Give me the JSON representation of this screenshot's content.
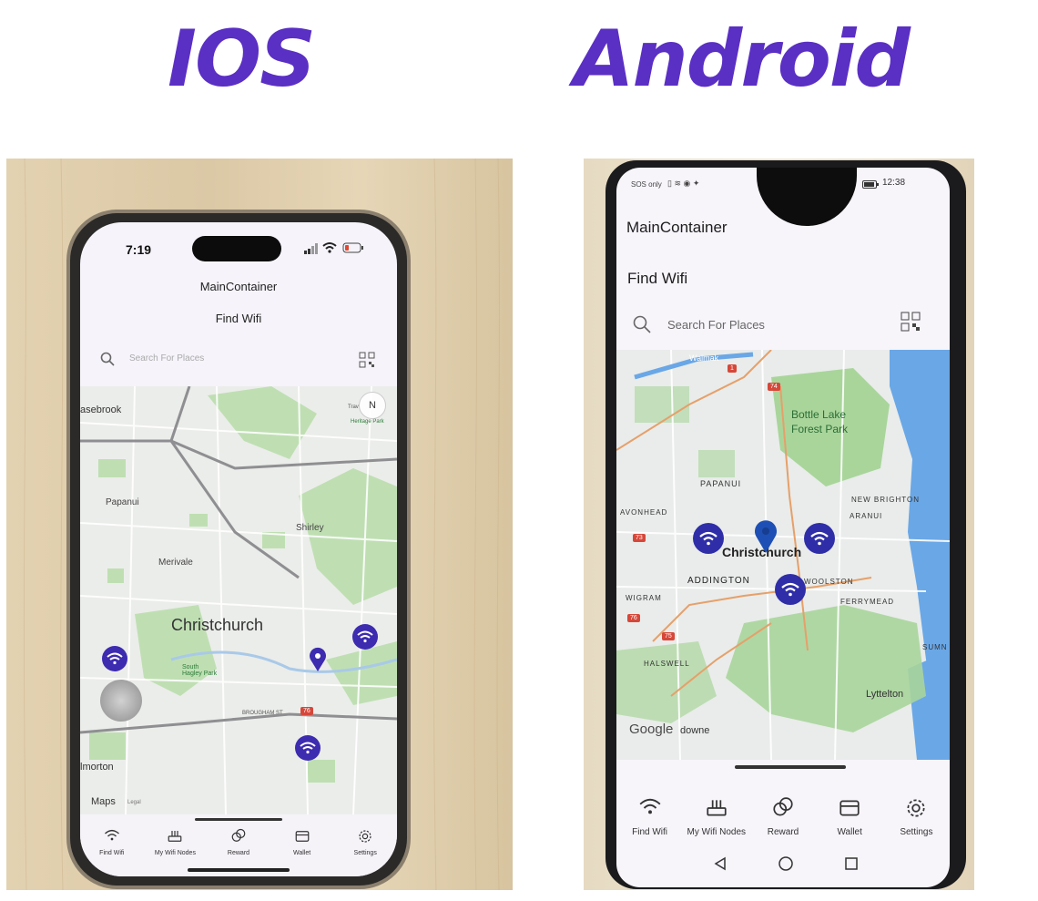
{
  "headings": {
    "ios": "IOS",
    "android": "Android"
  },
  "ios": {
    "status_time": "7:19",
    "app_title": "MainContainer",
    "page_title": "Find Wifi",
    "search_placeholder": "Search For Places",
    "map_labels": {
      "place1": "asebrook",
      "place2": "Papanui",
      "place3": "Shirley",
      "place4": "Merivale",
      "city": "Christchurch",
      "park": "South Hagley Park",
      "place5": "lmorton",
      "road": "BROUGHAM ST",
      "route": "76",
      "attribution": "Maps",
      "legal": "Legal",
      "compass": "N",
      "corner1": "Trav",
      "corner2": "Heritage Park"
    },
    "tabs": [
      {
        "label": "Find Wifi",
        "icon": "wifi-icon"
      },
      {
        "label": "My Wifi Nodes",
        "icon": "router-icon"
      },
      {
        "label": "Reward",
        "icon": "coins-icon"
      },
      {
        "label": "Wallet",
        "icon": "wallet-icon"
      },
      {
        "label": "Settings",
        "icon": "gear-icon"
      }
    ]
  },
  "android": {
    "status_left": "SOS only",
    "status_time": "12:38",
    "app_title": "MainContainer",
    "page_title": "Find Wifi",
    "search_placeholder": "Search For Places",
    "map_labels": {
      "top": "Waimak",
      "lake": "Bottle Lake",
      "forest": "Forest Park",
      "papanui": "PAPANUI",
      "new_brighton": "NEW BRIGHTON",
      "avonhead": "AVONHEAD",
      "aranui": "ARANUI",
      "city": "Christchurch",
      "addington": "ADDINGTON",
      "woolston": "WOOLSTON",
      "wigram": "WIGRAM",
      "ferrymead": "FERRYMEAD",
      "halswell": "HALSWELL",
      "sumner": "SUMN",
      "lyttelton": "Lyttelton",
      "google": "Google",
      "downe": "downe",
      "route1": "1",
      "route74": "74",
      "route73": "73",
      "route75": "75",
      "route76": "76"
    },
    "tabs": [
      {
        "label": "Find Wifi",
        "icon": "wifi-icon"
      },
      {
        "label": "My Wifi Nodes",
        "icon": "router-icon"
      },
      {
        "label": "Reward",
        "icon": "coins-icon"
      },
      {
        "label": "Wallet",
        "icon": "wallet-icon"
      },
      {
        "label": "Settings",
        "icon": "gear-icon"
      }
    ]
  },
  "colors": {
    "accent": "#5a2fc4",
    "marker": "#3d2bb0",
    "map_land": "#eef0ec",
    "map_park": "#b9dcae",
    "water": "#6aa7e6"
  }
}
